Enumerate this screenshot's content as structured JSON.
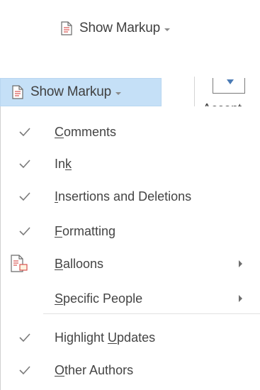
{
  "top_button": {
    "label": "Show Markup"
  },
  "open_button": {
    "label": "Show Markup"
  },
  "ribbon": {
    "accept_label": "Accept"
  },
  "menu": {
    "items": [
      {
        "before": "",
        "key": "C",
        "after": "omments",
        "checked": true
      },
      {
        "before": "In",
        "key": "k",
        "after": "",
        "checked": true
      },
      {
        "before": "",
        "key": "I",
        "after": "nsertions and Deletions",
        "checked": true
      },
      {
        "before": "",
        "key": "F",
        "after": "ormatting",
        "checked": true
      },
      {
        "before": "",
        "key": "B",
        "after": "alloons",
        "icon": "balloons-icon",
        "submenu": true
      },
      {
        "before": "",
        "key": "S",
        "after": "pecific People",
        "submenu": true
      },
      {
        "before": "Highlight ",
        "key": "U",
        "after": "pdates",
        "checked": true
      },
      {
        "before": "",
        "key": "O",
        "after": "ther Authors",
        "checked": true
      }
    ]
  },
  "colors": {
    "hover_blue": "#c5e0f7",
    "icon_orange": "#d9534f",
    "check_gray": "#7a7a7a"
  }
}
